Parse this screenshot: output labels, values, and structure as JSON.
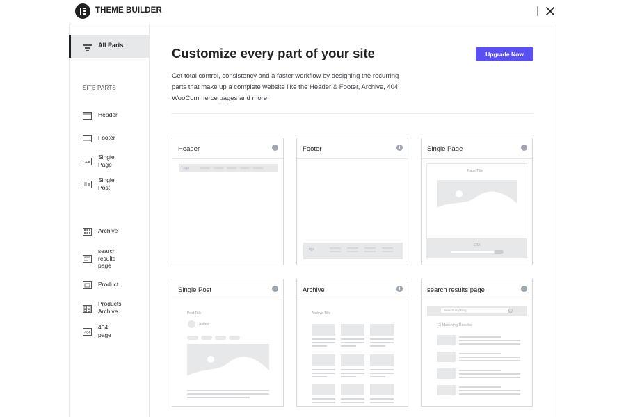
{
  "app": {
    "title": "THEME BUILDER"
  },
  "sidebar": {
    "all_parts": "All Parts",
    "section_title": "SITE PARTS",
    "items": [
      {
        "label": "Header",
        "icon": "header-icon"
      },
      {
        "label": "Footer",
        "icon": "footer-icon"
      },
      {
        "label": "Single\nPage",
        "icon": "single-page-icon"
      },
      {
        "label": "Single\nPost",
        "icon": "single-post-icon"
      },
      {
        "label": "Archive",
        "icon": "archive-icon"
      },
      {
        "label": "search\nresults\npage",
        "icon": "search-results-icon"
      },
      {
        "label": "Product",
        "icon": "product-icon"
      },
      {
        "label": "Products\nArchive",
        "icon": "products-archive-icon"
      },
      {
        "label": "404\npage",
        "icon": "404-icon"
      }
    ]
  },
  "main": {
    "headline": "Customize every part of your site",
    "description": "Get total control, consistency and a faster workflow by designing the recurring parts that make up a complete website like the Header & Footer, Archive, 404, WooCommerce pages and more.",
    "upgrade_label": "Upgrade Now",
    "cards": [
      {
        "title": "Header"
      },
      {
        "title": "Footer"
      },
      {
        "title": "Single Page"
      },
      {
        "title": "Single Post"
      },
      {
        "title": "Archive"
      },
      {
        "title": "search results page"
      }
    ],
    "previews": {
      "logo": "Logo",
      "page_title": "Page Title",
      "cta": "CTA",
      "post_title": "Post Title",
      "author": "Author",
      "archive_title": "Archive Title",
      "search_placeholder": "Search anything",
      "matching_results": "13 Matching Results"
    }
  },
  "colors": {
    "accent": "#5a4ff0",
    "text": "#1f2124",
    "border": "#d5d8dc"
  }
}
